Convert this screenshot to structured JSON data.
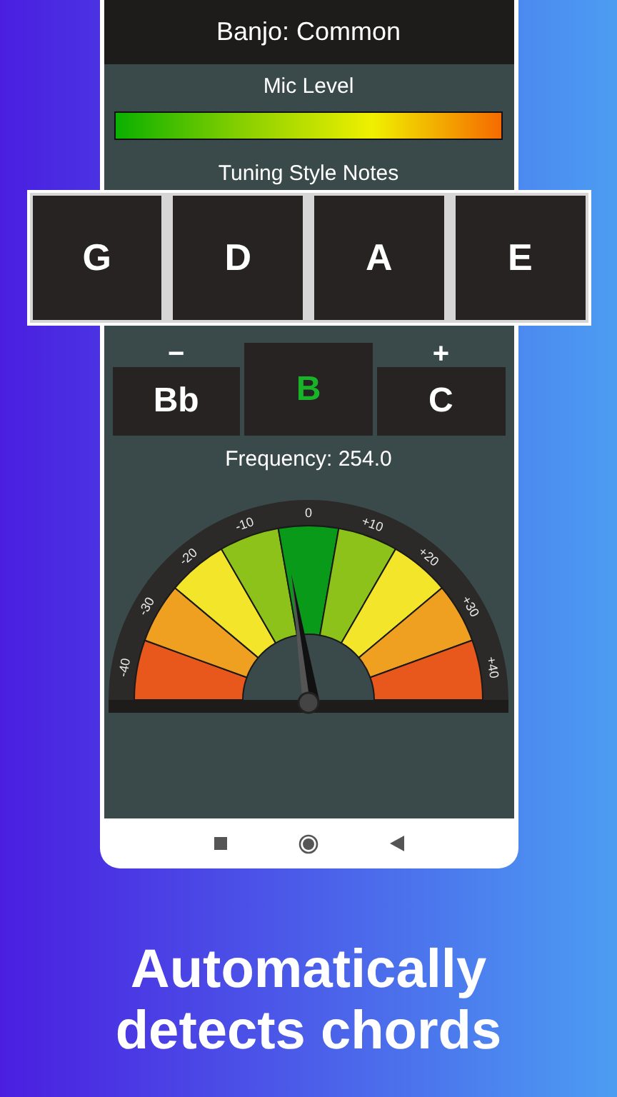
{
  "header": {
    "title": "Banjo: Common"
  },
  "mic": {
    "label": "Mic Level",
    "level": 1
  },
  "tuning": {
    "label": "Tuning Style Notes",
    "notes": [
      "G",
      "D",
      "A",
      "E"
    ]
  },
  "nearby": [
    {
      "sign": "−",
      "note": "Bb",
      "selected": false
    },
    {
      "note": "B",
      "selected": true
    },
    {
      "sign": "+",
      "note": "C",
      "selected": false
    }
  ],
  "frequency": "Frequency: 254.0",
  "gauge": {
    "ticks": [
      "-40",
      "-30",
      "-20",
      "-10",
      "0",
      "+10",
      "+20",
      "+30",
      "+40"
    ]
  },
  "caption": [
    "Automatically",
    "detects chords"
  ]
}
